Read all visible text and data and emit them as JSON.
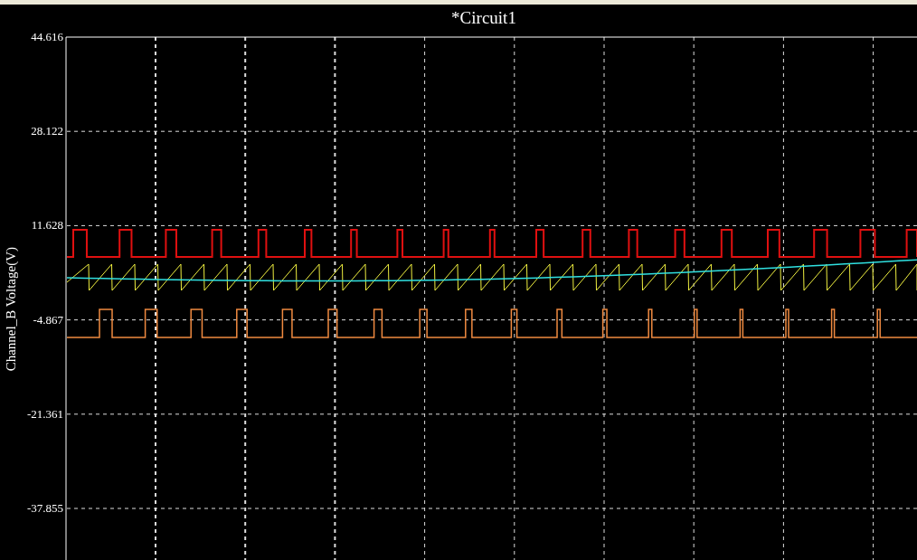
{
  "plot": {
    "title": "*Circuit1",
    "y_axis_label": "Channel_B Voltage(V)",
    "y_ticks": [
      "44.616",
      "28.122",
      "11.628",
      "-4.867",
      "-21.361",
      "-37.855"
    ]
  }
}
